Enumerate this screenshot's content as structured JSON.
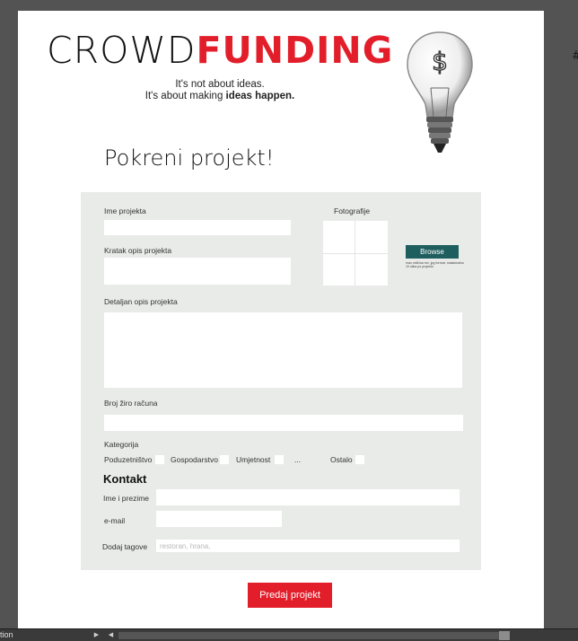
{
  "brand": {
    "logo_part1": "CROWD",
    "logo_part2": "FUNDING",
    "tagline_line1": "It's not about ideas.",
    "tagline_line2_prefix": "It's about making ",
    "tagline_line2_bold": "ideas happen.",
    "bulb_symbol": "$"
  },
  "page": {
    "title": "Pokreni projekt!"
  },
  "form": {
    "project_name_label": "Ime projekta",
    "short_desc_label": "Kratak opis projekta",
    "photos_label": "Fotografije",
    "browse_label": "Browse",
    "photo_note": "max veličina rez. jpg format, maksimalno 10 slika po projektu",
    "detail_desc_label": "Detaljan opis projekta",
    "account_label": "Broj žiro računa",
    "category_label": "Kategorija",
    "categories": [
      "Poduzetništvo",
      "Gospodarstvo",
      "Umjetnost",
      "...",
      "Ostalo"
    ],
    "contact_heading": "Kontakt",
    "fullname_label": "Ime i prezime",
    "email_label": "e-mail",
    "tags_label": "Dodaj tagove",
    "tags_placeholder": "restoran, hrana,",
    "submit_label": "Predaj projekt"
  },
  "app": {
    "status_text": "tion",
    "side_panel_glyph": "#"
  },
  "colors": {
    "accent": "#e21e2b",
    "browse": "#1f5e5f",
    "panel": "#e9ebe9",
    "workspace": "#535353"
  }
}
